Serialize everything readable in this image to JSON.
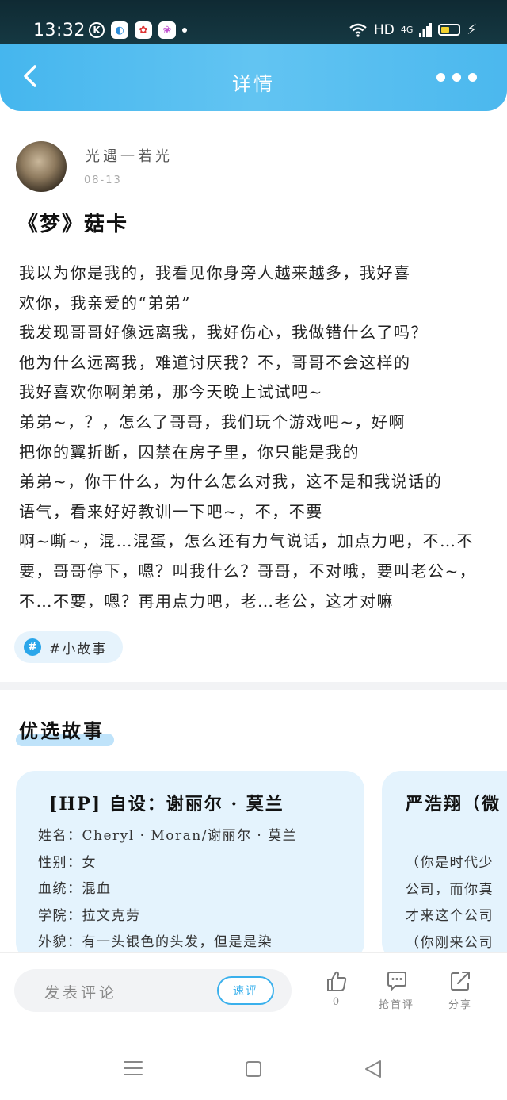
{
  "status_bar": {
    "time": "13:32",
    "network": "HD",
    "signal": "4G",
    "app_icons": [
      "k-icon",
      "browser-icon",
      "baidu-icon",
      "photo-icon"
    ],
    "battery_color": "#f3d230"
  },
  "header": {
    "title": "详情"
  },
  "post": {
    "author": "光遇一若光",
    "date": "08-13",
    "title": "《梦》菇卡",
    "body_lines": [
      "我以为你是我的，我看见你身旁人越来越多，我好喜",
      "欢你，我亲爱的“弟弟”",
      "我发现哥哥好像远离我，我好伤心，我做错什么了吗？",
      "他为什么远离我，难道讨厌我？不，哥哥不会这样的",
      "我好喜欢你啊弟弟，那今天晚上试试吧~",
      "弟弟~，？，怎么了哥哥，我们玩个游戏吧~，好啊",
      "把你的翼折断，囚禁在房子里，你只能是我的",
      "弟弟~，你干什么，为什么怎么对我，这不是和我说话的",
      "语气，看来好好教训一下吧~，不，不要",
      "啊~嘶~，混…混蛋，怎么还有力气说话，加点力吧，不…不",
      "要，哥哥停下，嗯？叫我什么？哥哥，不对哦，要叫老公~，",
      "不…不要，嗯？再用点力吧，老…老公，这才对嘛"
    ],
    "tag": "#小故事"
  },
  "featured": {
    "section_title": "优选故事",
    "cards": [
      {
        "title": "[HP] 自设：谢丽尔 · 莫兰",
        "lines": [
          "姓名：Cheryl · Moran/谢丽尔 · 莫兰",
          "性别：女",
          "血统：混血",
          "学院：拉文克劳",
          "外貌：有一头银色的头发，但是是染"
        ]
      },
      {
        "title": "严浩翔（微",
        "lines": [
          "（你是时代少",
          "公司，而你真",
          "才来这个公司",
          "（你刚来公司"
        ]
      }
    ]
  },
  "bottom_bar": {
    "comment_placeholder": "发表评论",
    "quick_comment": "速评",
    "like_count": "0",
    "grab_first": "抢首评",
    "share": "分享"
  },
  "colors": {
    "accent": "#3ab0ec",
    "header_gradient_start": "#45b6ee",
    "card_background": "#e4f3fd"
  }
}
